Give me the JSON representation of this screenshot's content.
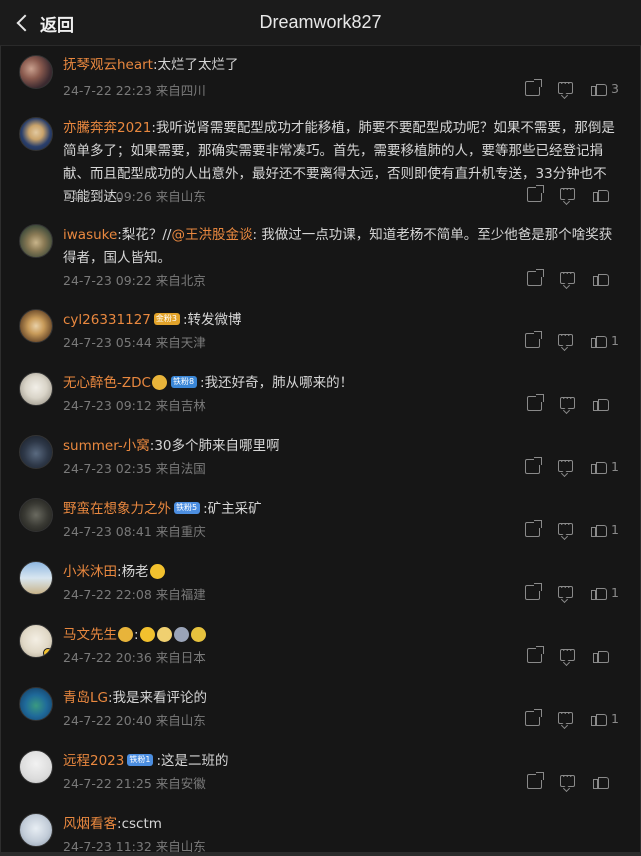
{
  "header": {
    "back_label": "返回",
    "title": "Dreamwork827"
  },
  "colors": {
    "background": "#161616",
    "username": "#e9883f",
    "meta": "#7a7a7a",
    "text": "#d6d6d6"
  },
  "comments": [
    {
      "user": "抚琴观云heart",
      "sep": ":",
      "text": "太烂了太烂了",
      "time": "24-7-22 22:23",
      "from": "来自四川",
      "likes": "3"
    },
    {
      "user": "亦騰奔奔2021",
      "sep": ":",
      "text": "我听说肾需要配型成功才能移植，肺要不要配型成功呢？如果不需要，那倒是简单多了；如果需要，那确实需要非常凑巧。首先，需要移植肺的人，要等那些已经登记捐献、而且配型成功的人出意外，最好还不要离得太远，否则即使有直升机专送，33分钟也不可能到达。",
      "time": "24-7-23 09:26",
      "from": "来自山东",
      "likes": ""
    },
    {
      "user": "iwasuke",
      "sep": ":",
      "text_before": "梨花？//",
      "mention": "@王洪股金谈",
      "text_after": ": 我做过一点功课，知道老杨不简单。至少他爸是那个啥奖获得者，国人皆知。",
      "time": "24-7-23 09:22",
      "from": "来自北京",
      "likes": ""
    },
    {
      "user": "cyl26331127",
      "tag": "金粉3",
      "sep": ":",
      "text": "转发微博",
      "time": "24-7-23 05:44",
      "from": "来自天津",
      "likes": "1"
    },
    {
      "user": "无心醉色-ZDC",
      "tag": "铁粉8",
      "sep": ":",
      "text": "我还好奇，肺从哪来的！",
      "time": "24-7-23 09:12",
      "from": "来自吉林",
      "likes": ""
    },
    {
      "user": "summer-小窝",
      "sep": ":",
      "text": "30多个肺来自哪里啊",
      "time": "24-7-23 02:35",
      "from": "来自法国",
      "likes": "1"
    },
    {
      "user": "野蛮在想象力之外",
      "tag": "铁粉5",
      "sep": ":",
      "text": "矿主采矿",
      "time": "24-7-23 08:41",
      "from": "来自重庆",
      "likes": "1"
    },
    {
      "user": "小米沐田",
      "sep": ":",
      "text": "杨老",
      "time": "24-7-22 22:08",
      "from": "来自福建",
      "likes": "1"
    },
    {
      "user": "马文先生",
      "sep": ":",
      "text": "",
      "time": "24-7-22 20:36",
      "from": "来自日本",
      "likes": ""
    },
    {
      "user": "青岛LG",
      "sep": ":",
      "text": "我是来看评论的",
      "time": "24-7-22 20:40",
      "from": "来自山东",
      "likes": "1"
    },
    {
      "user": "远程2023",
      "tag": "铁粉1",
      "sep": ":",
      "text": "这是二班的",
      "time": "24-7-22 21:25",
      "from": "来自安徽",
      "likes": ""
    },
    {
      "user": "风烟看客",
      "sep": ":",
      "text": "csctm",
      "time": "24-7-23 11:32",
      "from": "来自山东",
      "likes": ""
    }
  ]
}
